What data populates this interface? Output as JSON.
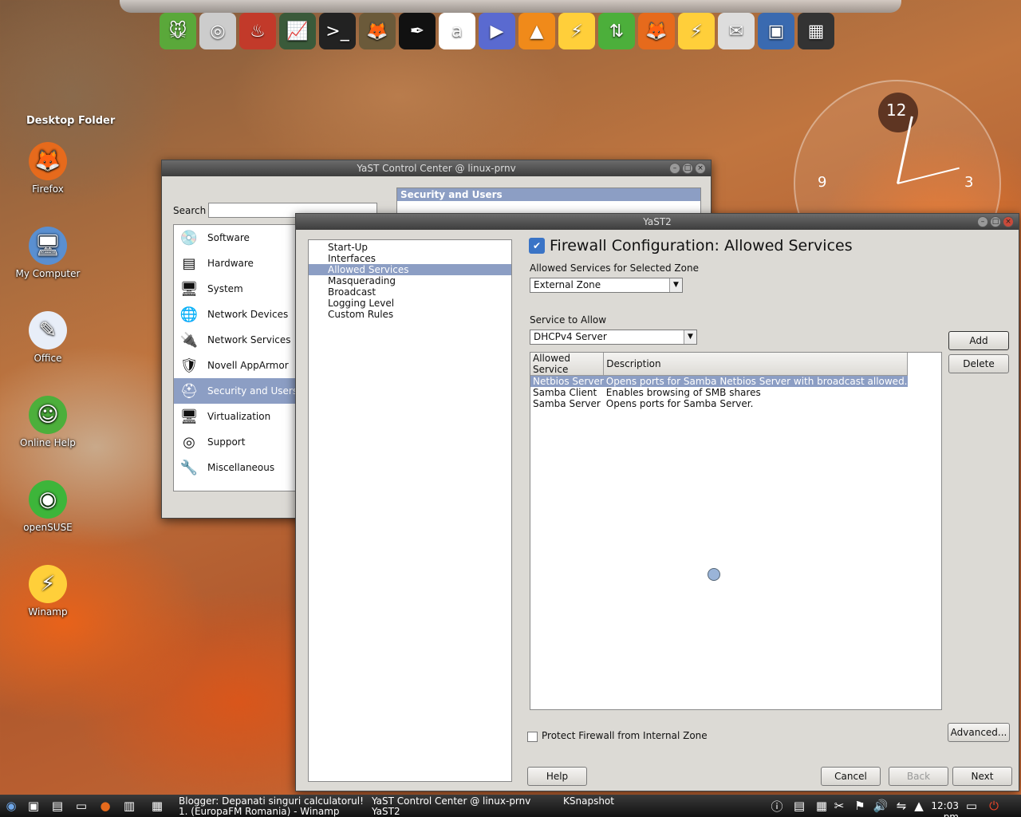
{
  "desktop": {
    "folder_title": "Desktop Folder",
    "icons": [
      {
        "label": "Firefox",
        "icon": "firefox-icon",
        "glyph": "🦊",
        "color": "#e66a1c"
      },
      {
        "label": "My Computer",
        "icon": "computer-icon",
        "glyph": "🖥",
        "color": "#5a8fd0"
      },
      {
        "label": "Office",
        "icon": "office-icon",
        "glyph": "✎",
        "color": "#e8eef8"
      },
      {
        "label": "Online Help",
        "icon": "help-icon",
        "glyph": "☺",
        "color": "#4caf3b"
      },
      {
        "label": "openSUSE",
        "icon": "opensuse-icon",
        "glyph": "◉",
        "color": "#3db53a"
      },
      {
        "label": "Winamp",
        "icon": "winamp-icon",
        "glyph": "⚡",
        "color": "#ffcf3a"
      }
    ]
  },
  "dock": {
    "icons": [
      {
        "name": "mouse-icon",
        "glyph": "🐭",
        "color": "#5aa83a"
      },
      {
        "name": "cd-burner-icon",
        "glyph": "◎",
        "color": "#cccccc"
      },
      {
        "name": "k3b-icon",
        "glyph": "♨",
        "color": "#c23a2a"
      },
      {
        "name": "system-monitor-icon",
        "glyph": "📈",
        "color": "#3a5a3a"
      },
      {
        "name": "terminal-icon",
        "glyph": ">_",
        "color": "#222222"
      },
      {
        "name": "gimp-icon",
        "glyph": "🦊",
        "color": "#6b5a3a"
      },
      {
        "name": "inkscape-icon",
        "glyph": "✒",
        "color": "#111111"
      },
      {
        "name": "amarok-icon",
        "glyph": "a",
        "color": "#ffffff"
      },
      {
        "name": "mplayer-icon",
        "glyph": "▶",
        "color": "#5a6ad0"
      },
      {
        "name": "vlc-icon",
        "glyph": "▲",
        "color": "#f08a1a"
      },
      {
        "name": "winamp-dock-icon",
        "glyph": "⚡",
        "color": "#ffcf3a"
      },
      {
        "name": "updater-icon",
        "glyph": "⇅",
        "color": "#4caf3b"
      },
      {
        "name": "firefox-dock-icon",
        "glyph": "🦊",
        "color": "#e66a1c"
      },
      {
        "name": "winamp2-dock-icon",
        "glyph": "⚡",
        "color": "#ffcf3a"
      },
      {
        "name": "mail-icon",
        "glyph": "✉",
        "color": "#dddddd"
      },
      {
        "name": "desktop-icon",
        "glyph": "▣",
        "color": "#3a6ab0"
      },
      {
        "name": "pager-icon",
        "glyph": "▦",
        "color": "#333333"
      }
    ]
  },
  "clock": {
    "twelve": "12",
    "three": "3",
    "nine": "9"
  },
  "control_center": {
    "title": "YaST Control Center @ linux-prnv",
    "search_label": "Search",
    "search_value": "",
    "right_header": "Security and Users",
    "categories": [
      {
        "label": "Software",
        "icon": "software-icon",
        "glyph": "💿"
      },
      {
        "label": "Hardware",
        "icon": "hardware-icon",
        "glyph": "▤"
      },
      {
        "label": "System",
        "icon": "system-icon",
        "glyph": "🖥"
      },
      {
        "label": "Network Devices",
        "icon": "network-devices-icon",
        "glyph": "🌐"
      },
      {
        "label": "Network Services",
        "icon": "network-services-icon",
        "glyph": "🔌"
      },
      {
        "label": "Novell AppArmor",
        "icon": "apparmor-icon",
        "glyph": "🛡"
      },
      {
        "label": "Security and Users",
        "icon": "security-icon",
        "glyph": "⛑"
      },
      {
        "label": "Virtualization",
        "icon": "virtualization-icon",
        "glyph": "🖥"
      },
      {
        "label": "Support",
        "icon": "support-icon",
        "glyph": "◎"
      },
      {
        "label": "Miscellaneous",
        "icon": "miscellaneous-icon",
        "glyph": "🔧"
      }
    ],
    "selected_index": 6
  },
  "yast2": {
    "title": "YaST2",
    "heading": "Firewall Configuration: Allowed Services",
    "nav": [
      "Start-Up",
      "Interfaces",
      "Allowed Services",
      "Masquerading",
      "Broadcast",
      "Logging Level",
      "Custom Rules"
    ],
    "nav_selected": 2,
    "zone_label": "Allowed Services for Selected Zone",
    "zone_value": "External Zone",
    "service_label": "Service to Allow",
    "service_value": "DHCPv4 Server",
    "add_label": "Add",
    "delete_label": "Delete",
    "table": {
      "headers": [
        "Allowed Service",
        "Description"
      ],
      "rows": [
        [
          "Netbios Server",
          "Opens ports for Samba Netbios Server with broadcast allowed."
        ],
        [
          "Samba Client",
          "Enables browsing of SMB shares"
        ],
        [
          "Samba Server",
          "Opens ports for Samba Server."
        ]
      ],
      "selected": 0
    },
    "advanced_label": "Advanced...",
    "protect_label": "Protect Firewall from Internal Zone",
    "protect_checked": false,
    "help_label": "Help",
    "cancel_label": "Cancel",
    "back_label": "Back",
    "next_label": "Next"
  },
  "taskbar": {
    "tasks": [
      {
        "line1": "Blogger: Depanati singuri calculatorul!",
        "line2": "1. (EuropaFM Romania) - Winamp"
      },
      {
        "line1": "YaST Control Center @ linux-prnv",
        "line2": "YaST2"
      },
      {
        "line1": "KSnapshot",
        "line2": ""
      }
    ],
    "time": "12:03 pm"
  }
}
